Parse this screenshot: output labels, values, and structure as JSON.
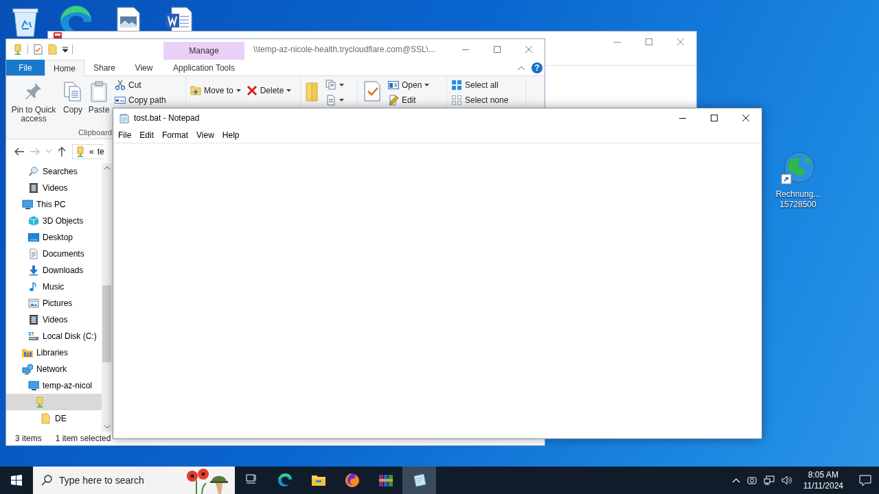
{
  "desktop": {
    "shortcut": {
      "label_lines": [
        "Rechnung...",
        "15728500"
      ]
    }
  },
  "explorer": {
    "title": "\\\\temp-az-nicole-health.trycloudflare.com@SSL\\...",
    "context_group": "Manage",
    "help": "?",
    "tabs": [
      {
        "label": "File",
        "kind": "file",
        "selected": false
      },
      {
        "label": "Home",
        "kind": "tab",
        "selected": true
      },
      {
        "label": "Share",
        "kind": "tab",
        "selected": false
      },
      {
        "label": "View",
        "kind": "tab",
        "selected": false
      },
      {
        "label": "Application Tools",
        "kind": "contextual",
        "selected": false
      }
    ],
    "ribbon": [
      {
        "label": "Clipboard",
        "columns": [
          [
            {
              "kind": "pin",
              "label": "Pin to Quick access",
              "dropdown": false
            }
          ],
          [
            {
              "kind": "copy",
              "label": "Copy",
              "dropdown": false
            }
          ],
          [
            {
              "kind": "paste",
              "label": "Paste",
              "dropdown": false
            }
          ],
          [
            {
              "kind": "cut",
              "label": "Cut",
              "dropdown": false
            },
            {
              "kind": "copy-path",
              "label": "Copy path",
              "dropdown": false
            }
          ]
        ]
      },
      {
        "columns": [
          [
            {
              "kind": "move-to",
              "label": "Move to",
              "dropdown": true
            }
          ],
          [
            {
              "kind": "delete",
              "label": "Delete",
              "dropdown": true
            }
          ]
        ]
      },
      {
        "columns": [
          [
            {
              "kind": "new-folder",
              "dropdown": false
            }
          ],
          [
            {
              "kind": "new-item",
              "dropdown": true
            },
            {
              "kind": "easy-access",
              "dropdown": true
            }
          ]
        ]
      },
      {
        "columns": [
          [
            {
              "kind": "properties",
              "dropdown": false
            }
          ],
          [
            {
              "kind": "open",
              "label": "Open",
              "dropdown": true
            },
            {
              "kind": "edit",
              "label": "Edit",
              "dropdown": false
            }
          ]
        ]
      },
      {
        "columns": [
          [
            {
              "kind": "select-all",
              "label": "Select all",
              "dropdown": false
            },
            {
              "kind": "select-none",
              "label": "Select none",
              "dropdown": false
            }
          ]
        ]
      }
    ],
    "address": {
      "prefix": "«",
      "text": "te"
    },
    "nav": {
      "branch_tail": [
        {
          "label": "Searches",
          "kind": "search",
          "selected": false
        },
        {
          "label": "Videos",
          "kind": "video",
          "selected": false
        }
      ],
      "tree": [
        {
          "label": "This PC",
          "kind": "pc",
          "selected": false,
          "children": [
            {
              "label": "3D Objects",
              "kind": "cube",
              "selected": false
            },
            {
              "label": "Desktop",
              "kind": "desktop",
              "selected": false
            },
            {
              "label": "Documents",
              "kind": "document",
              "selected": false
            },
            {
              "label": "Downloads",
              "kind": "download",
              "selected": false
            },
            {
              "label": "Music",
              "kind": "music",
              "selected": false
            },
            {
              "label": "Pictures",
              "kind": "picture",
              "selected": false
            },
            {
              "label": "Videos",
              "kind": "video",
              "selected": false
            },
            {
              "label": "Local Disk (C:)",
              "kind": "disk",
              "selected": false
            }
          ]
        },
        {
          "label": "Libraries",
          "kind": "library",
          "selected": false
        },
        {
          "label": "Network",
          "kind": "network",
          "selected": false,
          "children": [
            {
              "label": "temp-az-nicol",
              "kind": "pc",
              "selected": false,
              "children": [
                {
                  "kind": "share",
                  "selected": true,
                  "children": [
                    {
                      "label": "DE",
                      "kind": "folder",
                      "selected": false
                    }
                  ]
                }
              ]
            }
          ]
        }
      ]
    },
    "status": [
      "3 items",
      "1 item selected"
    ]
  },
  "notepad": {
    "title": "tost.bat - Notepad",
    "menu": [
      "File",
      "Edit",
      "Format",
      "View",
      "Help"
    ]
  },
  "taskbar": {
    "search": {
      "placeholder": "Type here to search"
    },
    "apps": [
      {
        "kind": "task-view",
        "selected": false
      },
      {
        "kind": "edge",
        "selected": false
      },
      {
        "kind": "explorer",
        "selected": false
      },
      {
        "kind": "firefox",
        "selected": false
      },
      {
        "kind": "winrar",
        "selected": false
      },
      {
        "kind": "notepad",
        "selected": true
      }
    ],
    "clock": {
      "time": "8:05 AM",
      "date": "11/11/2024"
    }
  }
}
